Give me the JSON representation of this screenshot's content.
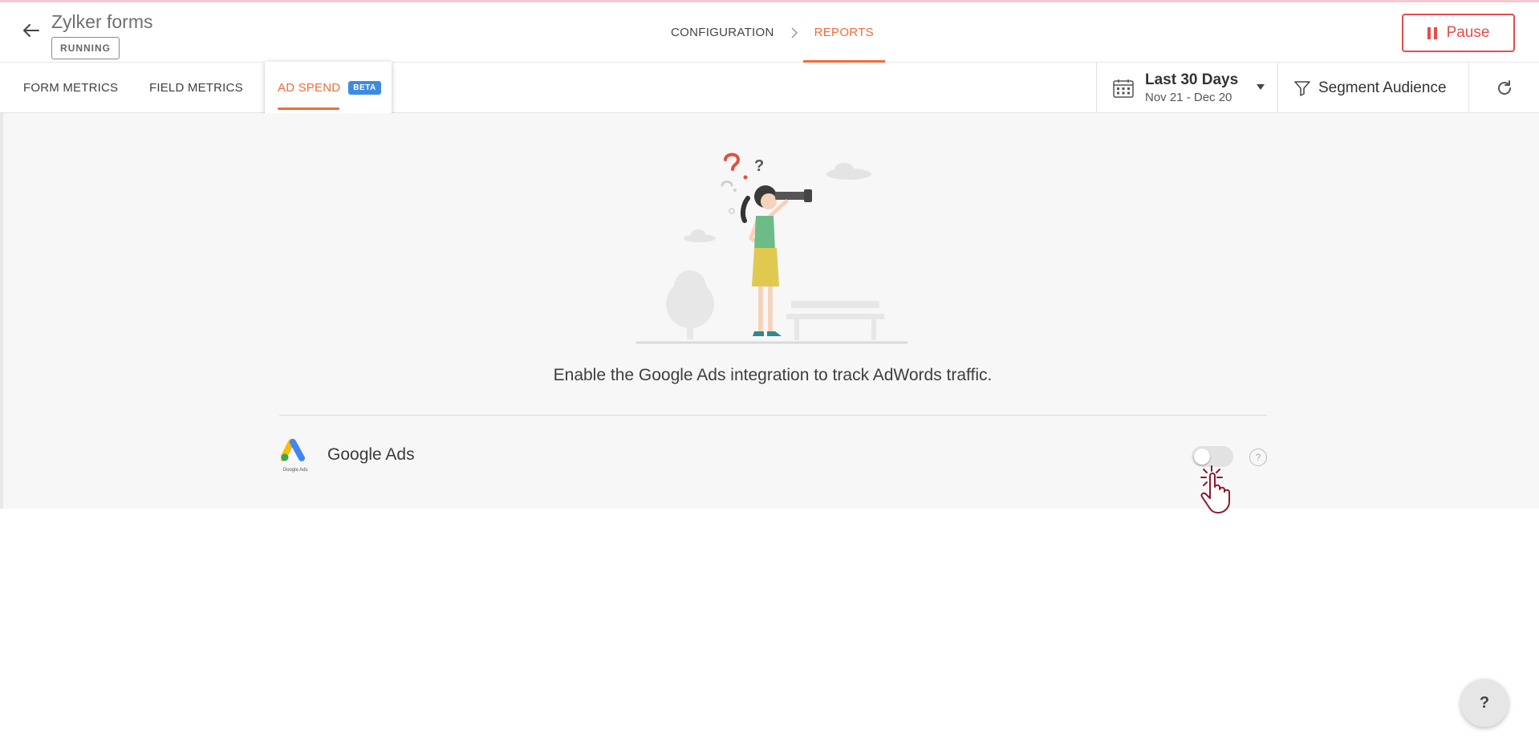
{
  "header": {
    "form_title": "Zylker forms",
    "status": "RUNNING",
    "breadcrumbs": [
      {
        "label": "CONFIGURATION",
        "active": false
      },
      {
        "label": "REPORTS",
        "active": true
      }
    ],
    "pause_label": "Pause"
  },
  "tabs": [
    {
      "label": "FORM METRICS",
      "active": false
    },
    {
      "label": "FIELD METRICS",
      "active": false
    },
    {
      "label": "AD SPEND",
      "active": true,
      "badge": "BETA"
    }
  ],
  "date_range": {
    "label": "Last 30 Days",
    "range": "Nov 21 - Dec 20"
  },
  "segment": {
    "label": "Segment Audience"
  },
  "content": {
    "message": "Enable the Google Ads integration to track AdWords traffic.",
    "integration": {
      "name": "Google Ads",
      "logo_caption": "Google Ads",
      "enabled": false
    }
  },
  "help_fab": {
    "label": "?"
  },
  "colors": {
    "accent": "#ef6c3a",
    "pause": "#e84b4b",
    "beta": "#3d8be0"
  }
}
